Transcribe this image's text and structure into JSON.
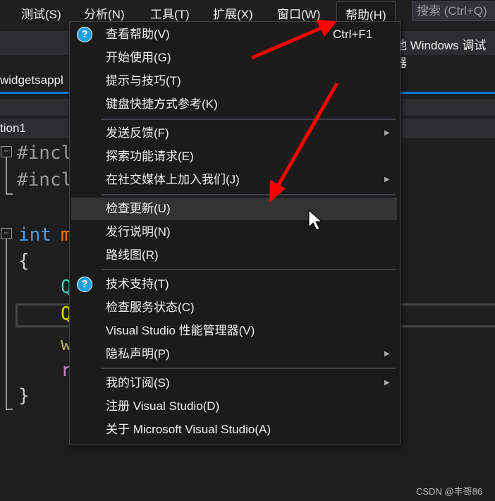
{
  "menubar": {
    "items": [
      "测试(S)",
      "分析(N)",
      "工具(T)",
      "扩展(X)",
      "窗口(W)",
      "帮助(H)"
    ],
    "search_placeholder": "搜索 (Ctrl+Q)"
  },
  "background": {
    "toolbar_text": "地 Windows 调试器",
    "tab": "widgetsappl",
    "solution": "tion1",
    "code": [
      "#incl",
      "#incl",
      "int",
      "m",
      "{",
      "Q",
      "Q",
      "w",
      "r",
      "}"
    ]
  },
  "help_menu": {
    "groups": [
      [
        {
          "label": "查看帮助(V)",
          "shortcut": "Ctrl+F1",
          "icon": "help-icon"
        },
        {
          "label": "开始使用(G)"
        },
        {
          "label": "提示与技巧(T)"
        },
        {
          "label": "键盘快捷方式参考(K)"
        }
      ],
      [
        {
          "label": "发送反馈(F)",
          "submenu": true
        },
        {
          "label": "探索功能请求(E)"
        },
        {
          "label": "在社交媒体上加入我们(J)",
          "submenu": true
        }
      ],
      [
        {
          "label": "检查更新(U)",
          "highlighted": true
        },
        {
          "label": "发行说明(N)"
        },
        {
          "label": "路线图(R)"
        }
      ],
      [
        {
          "label": "技术支持(T)",
          "icon": "help-icon"
        },
        {
          "label": "检查服务状态(C)"
        },
        {
          "label": "Visual Studio 性能管理器(V)"
        },
        {
          "label": "隐私声明(P)",
          "submenu": true
        }
      ],
      [
        {
          "label": "我的订阅(S)",
          "submenu": true
        },
        {
          "label": "注册 Visual Studio(D)"
        },
        {
          "label": "关于 Microsoft Visual Studio(A)"
        }
      ]
    ]
  },
  "watermark": "CSDN @丰哥86",
  "colors": {
    "accent": "#007acc",
    "arrow": "#ff0000",
    "highlight": "#333334"
  }
}
